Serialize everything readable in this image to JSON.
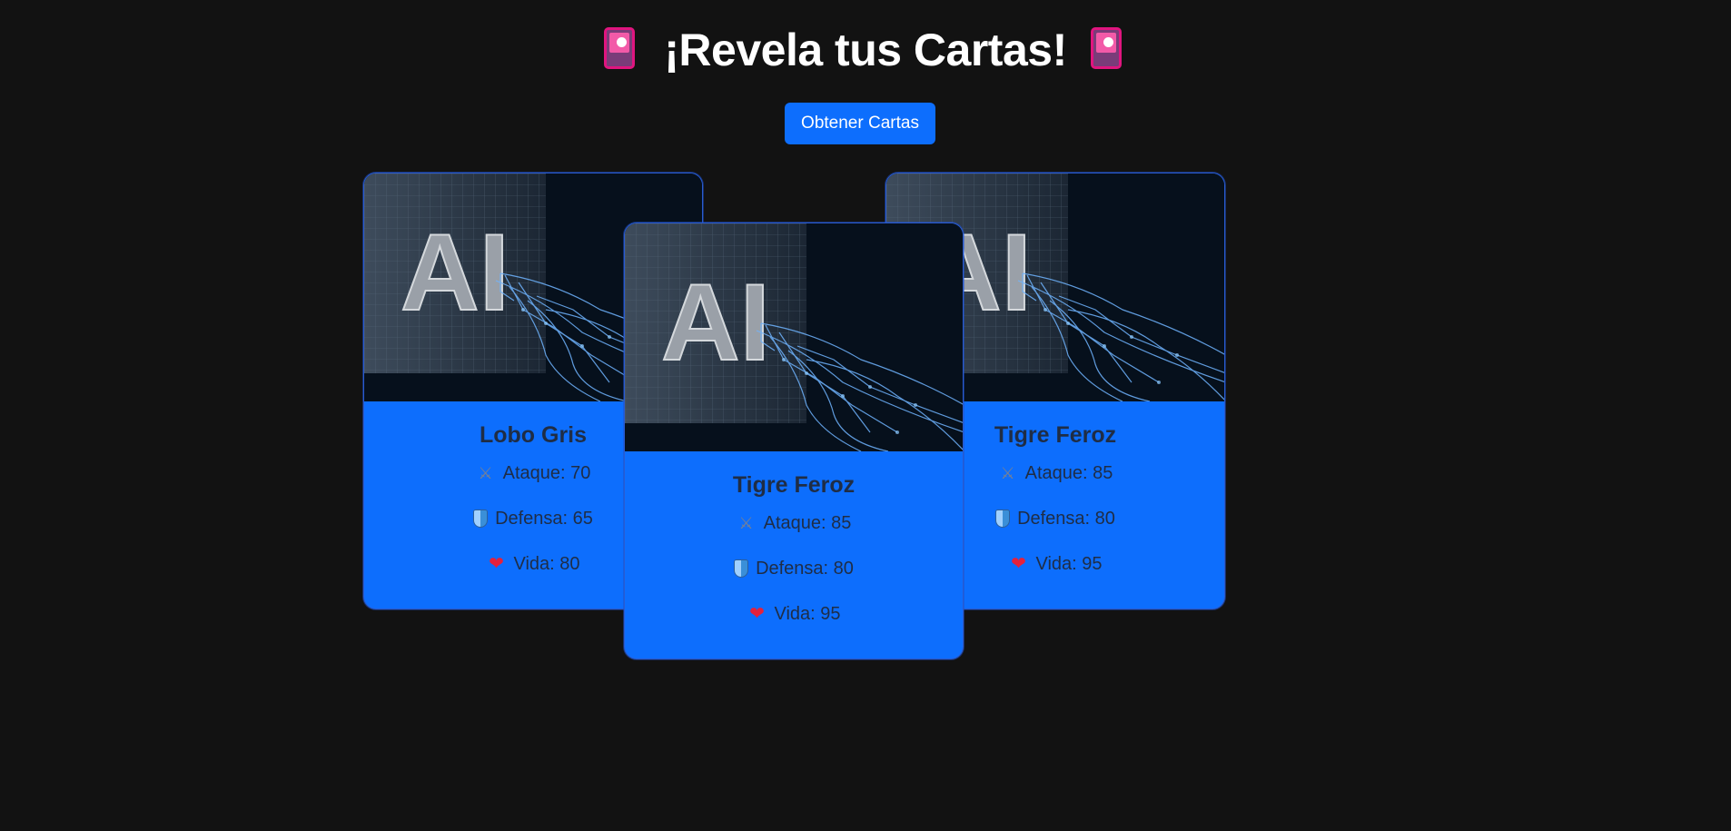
{
  "header": {
    "title": "¡Revela tus Cartas!",
    "icon": "card-index-icon"
  },
  "button": {
    "label": "Obtener Cartas"
  },
  "colors": {
    "background": "#121212",
    "card": "#0d6efd",
    "button": "#0d6efd",
    "icon_accent": "#e0157f"
  },
  "image_text": "AI",
  "cards": [
    {
      "name": "Lobo Gris",
      "attack": "Ataque: 70",
      "defense": "Defensa: 65",
      "life": "Vida: 80"
    },
    {
      "name": "Tigre Feroz",
      "attack": "Ataque: 85",
      "defense": "Defensa: 80",
      "life": "Vida: 95"
    },
    {
      "name": "Tigre Feroz",
      "attack": "Ataque: 85",
      "defense": "Defensa: 80",
      "life": "Vida: 95"
    }
  ]
}
